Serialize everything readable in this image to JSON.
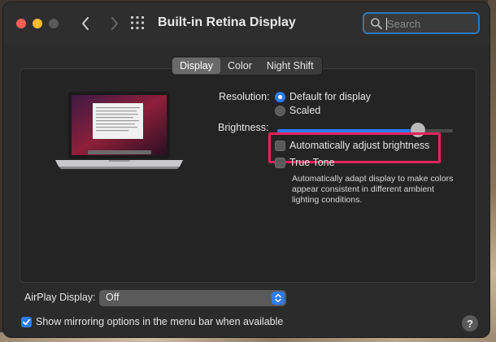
{
  "window": {
    "title": "Built-in Retina Display"
  },
  "search": {
    "placeholder": "Search",
    "value": ""
  },
  "tabs": [
    {
      "label": "Display",
      "active": true
    },
    {
      "label": "Color",
      "active": false
    },
    {
      "label": "Night Shift",
      "active": false
    }
  ],
  "resolution": {
    "label": "Resolution:",
    "options": [
      {
        "label": "Default for display",
        "selected": true
      },
      {
        "label": "Scaled",
        "selected": false
      }
    ]
  },
  "brightness": {
    "label": "Brightness:",
    "level": 0.8,
    "auto_adjust_label": "Automatically adjust brightness",
    "auto_adjust_checked": false
  },
  "true_tone": {
    "label": "True Tone",
    "checked": false,
    "description": "Automatically adapt display to make colors appear consistent in different ambient lighting conditions."
  },
  "airplay": {
    "label": "AirPlay Display:",
    "value": "Off"
  },
  "mirroring": {
    "label": "Show mirroring options in the menu bar when available",
    "checked": true
  },
  "help": {
    "label": "?"
  },
  "colors": {
    "accent": "#2d7cf6",
    "highlight": "#e4245f",
    "close": "#fe5f57",
    "minimize": "#febc2e"
  },
  "icons": {
    "back": "chevron-left-icon",
    "forward": "chevron-right-icon",
    "grid": "grid-icon",
    "search": "search-icon",
    "select": "updown-chevron-icon",
    "checkmark": "checkmark-icon"
  }
}
